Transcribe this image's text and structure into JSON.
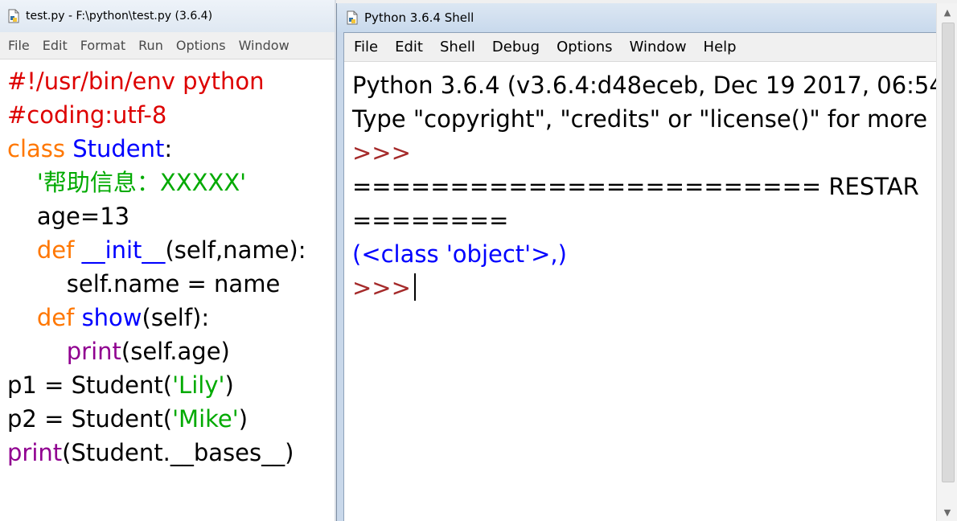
{
  "editor": {
    "title": "test.py - F:\\python\\test.py (3.6.4)",
    "menu": [
      "File",
      "Edit",
      "Format",
      "Run",
      "Options",
      "Window"
    ],
    "lines": [
      [
        {
          "t": "#!/usr/bin/env python",
          "c": "comment"
        }
      ],
      [
        {
          "t": "#coding:utf-8",
          "c": "comment"
        }
      ],
      [
        {
          "t": "class",
          "c": "keyword"
        },
        {
          "t": " "
        },
        {
          "t": "Student",
          "c": "def"
        },
        {
          "t": ":"
        }
      ],
      [
        {
          "t": "    "
        },
        {
          "t": "'帮助信息：XXXXX'",
          "c": "string"
        }
      ],
      [
        {
          "t": "    age=13"
        }
      ],
      [
        {
          "t": "    "
        },
        {
          "t": "def",
          "c": "keyword"
        },
        {
          "t": " "
        },
        {
          "t": "__init__",
          "c": "def"
        },
        {
          "t": "(self,name):"
        }
      ],
      [
        {
          "t": "        self.name = name"
        }
      ],
      [
        {
          "t": "    "
        },
        {
          "t": "def",
          "c": "keyword"
        },
        {
          "t": " "
        },
        {
          "t": "show",
          "c": "def"
        },
        {
          "t": "(self):"
        }
      ],
      [
        {
          "t": "        "
        },
        {
          "t": "print",
          "c": "builtin"
        },
        {
          "t": "(self.age)"
        }
      ],
      [
        {
          "t": "p1 = Student("
        },
        {
          "t": "'Lily'",
          "c": "string"
        },
        {
          "t": ")"
        }
      ],
      [
        {
          "t": "p2 = Student("
        },
        {
          "t": "'Mike'",
          "c": "string"
        },
        {
          "t": ")"
        }
      ],
      [
        {
          "t": "print",
          "c": "builtin"
        },
        {
          "t": "(Student.__bases__)"
        }
      ]
    ]
  },
  "shell": {
    "title": "Python 3.6.4 Shell",
    "menu": [
      "File",
      "Edit",
      "Shell",
      "Debug",
      "Options",
      "Window",
      "Help"
    ],
    "lines": [
      [
        {
          "t": "Python 3.6.4 (v3.6.4:d48eceb, Dec 19 2017, 06:54:"
        }
      ],
      [
        {
          "t": "Type \"copyright\", \"credits\" or \"license()\" for more"
        }
      ],
      [
        {
          "t": ">>>",
          "c": "prompt"
        }
      ],
      [
        {
          "t": "======================== RESTAR"
        }
      ],
      [
        {
          "t": "========"
        }
      ],
      [
        {
          "t": "(<class 'object'>,)",
          "c": "out"
        }
      ],
      [
        {
          "t": ">>>",
          "c": "prompt",
          "cursor": true
        }
      ]
    ]
  },
  "colors": {
    "comment": "#dd0000",
    "keyword": "#ff7700",
    "def": "#0000ff",
    "string": "#00aa00",
    "builtin": "#900090",
    "prompt": "#a52a2a",
    "output": "#0000ff"
  },
  "icons": {
    "editor_title": "python-file-icon",
    "shell_title": "python-file-icon",
    "scroll_up": "chevron-up-icon",
    "scroll_down": "chevron-down-icon"
  }
}
